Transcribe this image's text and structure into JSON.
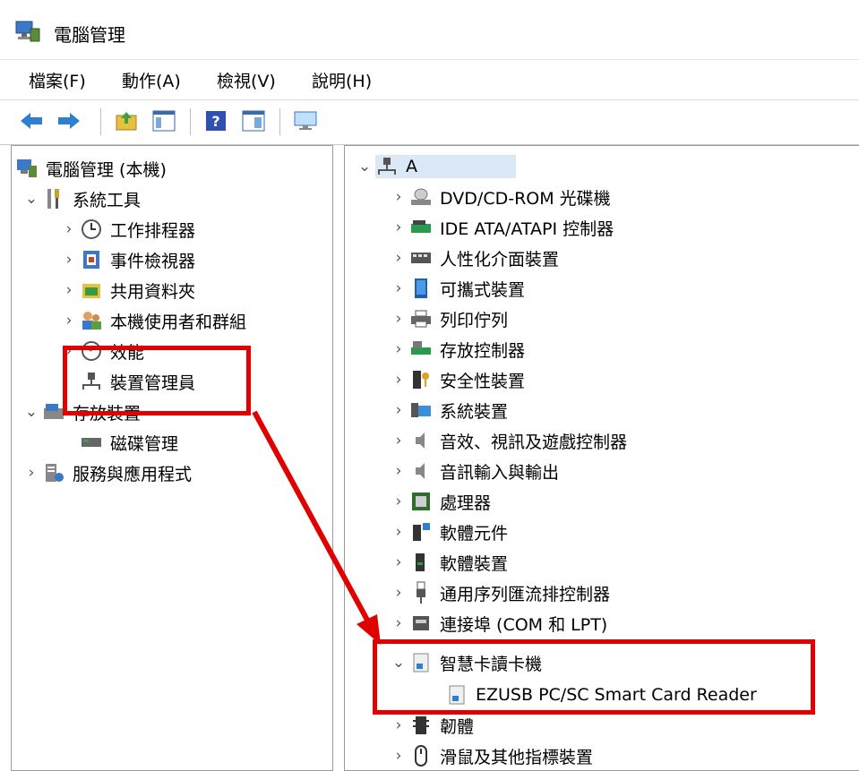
{
  "window": {
    "title": "電腦管理"
  },
  "menu": [
    {
      "label": "檔案(F)"
    },
    {
      "label": "動作(A)"
    },
    {
      "label": "檢視(V)"
    },
    {
      "label": "說明(H)"
    }
  ],
  "toolbar": [
    {
      "icon": "back-icon"
    },
    {
      "icon": "forward-icon"
    },
    {
      "icon": "up-folder-icon"
    },
    {
      "icon": "show-hide-tree-icon"
    },
    {
      "icon": "help-icon"
    },
    {
      "icon": "show-action-pane-icon"
    },
    {
      "icon": "monitor-icon"
    }
  ],
  "left_tree": [
    {
      "label": "電腦管理 (本機)",
      "icon": "computer-management-icon",
      "expander": ""
    },
    {
      "label": "系統工具",
      "icon": "tools-icon",
      "expander": "⌄"
    },
    {
      "label": "工作排程器",
      "icon": "clock-icon",
      "expander": "›"
    },
    {
      "label": "事件檢視器",
      "icon": "event-viewer-icon",
      "expander": "›"
    },
    {
      "label": "共用資料夾",
      "icon": "shared-folder-icon",
      "expander": "›"
    },
    {
      "label": "本機使用者和群組",
      "icon": "users-icon",
      "expander": "›"
    },
    {
      "label": "效能",
      "icon": "performance-icon",
      "expander": "›"
    },
    {
      "label": "裝置管理員",
      "icon": "device-manager-icon",
      "expander": ""
    },
    {
      "label": "存放裝置",
      "icon": "storage-icon",
      "expander": "⌄"
    },
    {
      "label": "磁碟管理",
      "icon": "disk-management-icon",
      "expander": ""
    },
    {
      "label": "服務與應用程式",
      "icon": "services-icon",
      "expander": "›"
    }
  ],
  "right_tree": {
    "root": {
      "label": "A",
      "icon": "computer-icon",
      "expander": "⌄"
    },
    "items": [
      {
        "label": "DVD/CD-ROM 光碟機",
        "icon": "dvd-icon",
        "expander": "›"
      },
      {
        "label": "IDE ATA/ATAPI 控制器",
        "icon": "ide-controller-icon",
        "expander": "›"
      },
      {
        "label": "人性化介面裝置",
        "icon": "hid-icon",
        "expander": "›"
      },
      {
        "label": "可攜式裝置",
        "icon": "portable-device-icon",
        "expander": "›"
      },
      {
        "label": "列印佇列",
        "icon": "printer-icon",
        "expander": "›"
      },
      {
        "label": "存放控制器",
        "icon": "storage-controller-icon",
        "expander": "›"
      },
      {
        "label": "安全性裝置",
        "icon": "security-key-icon",
        "expander": "›"
      },
      {
        "label": "系統裝置",
        "icon": "system-device-icon",
        "expander": "›"
      },
      {
        "label": "音效、視訊及遊戲控制器",
        "icon": "speaker-icon",
        "expander": "›"
      },
      {
        "label": "音訊輸入與輸出",
        "icon": "speaker-icon",
        "expander": "›"
      },
      {
        "label": "處理器",
        "icon": "processor-icon",
        "expander": "›"
      },
      {
        "label": "軟體元件",
        "icon": "software-component-icon",
        "expander": "›"
      },
      {
        "label": "軟體裝置",
        "icon": "software-device-icon",
        "expander": "›"
      },
      {
        "label": "通用序列匯流排控制器",
        "icon": "usb-icon",
        "expander": "›"
      },
      {
        "label": "連接埠 (COM 和 LPT)",
        "icon": "port-icon",
        "expander": "›"
      },
      {
        "label": "智慧卡讀卡機",
        "icon": "smart-card-reader-icon",
        "expander": "⌄"
      },
      {
        "label": "EZUSB PC/SC Smart Card Reader",
        "icon": "smart-card-reader-icon",
        "expander": ""
      },
      {
        "label": "韌體",
        "icon": "firmware-icon",
        "expander": "›"
      },
      {
        "label": "滑鼠及其他指標裝置",
        "icon": "mouse-icon",
        "expander": "›"
      }
    ]
  },
  "colors": {
    "highlight": "#e00000",
    "selection": "#dbe8f5"
  }
}
